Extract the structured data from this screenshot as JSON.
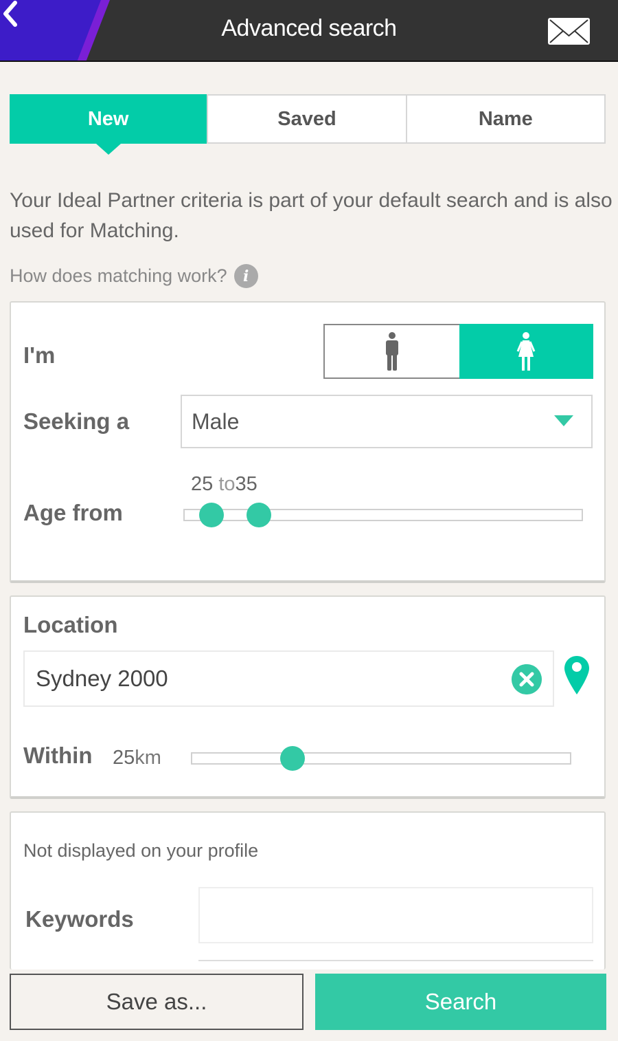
{
  "header": {
    "title": "Advanced search",
    "back_icon": "chevron-left-icon",
    "mail_icon": "envelope-icon",
    "colors": {
      "bar": "#333333",
      "accent_left": "#3d1cc8",
      "accent_stripe": "#7a1fd6"
    }
  },
  "tabs": [
    {
      "label": "New",
      "active": true
    },
    {
      "label": "Saved",
      "active": false
    },
    {
      "label": "Name",
      "active": false
    }
  ],
  "intro_text": "Your Ideal Partner criteria is part of your default search and is also used for Matching.",
  "how_link": {
    "label": "How does matching work?",
    "icon": "info-icon"
  },
  "criteria": {
    "im_label": "I'm",
    "gender_options": [
      {
        "value": "male",
        "icon": "male-icon",
        "selected": false
      },
      {
        "value": "female",
        "icon": "female-icon",
        "selected": true
      }
    ],
    "seeking_label": "Seeking a",
    "seeking_value": "Male",
    "age_label": "Age from",
    "age_from": "25",
    "age_to_word": "to",
    "age_to": "35"
  },
  "location": {
    "label": "Location",
    "value": "Sydney 2000",
    "clear_icon": "clear-icon",
    "pin_icon": "location-pin-icon",
    "within_label": "Within",
    "within_value": "25",
    "within_unit": "km"
  },
  "private": {
    "note": "Not displayed on your profile",
    "keywords_label": "Keywords",
    "keywords_value": ""
  },
  "footer": {
    "save_label": "Save as...",
    "search_label": "Search"
  },
  "colors": {
    "accent": "#03cca8",
    "button_accent": "#33c9a5",
    "background": "#f5f2ee"
  }
}
